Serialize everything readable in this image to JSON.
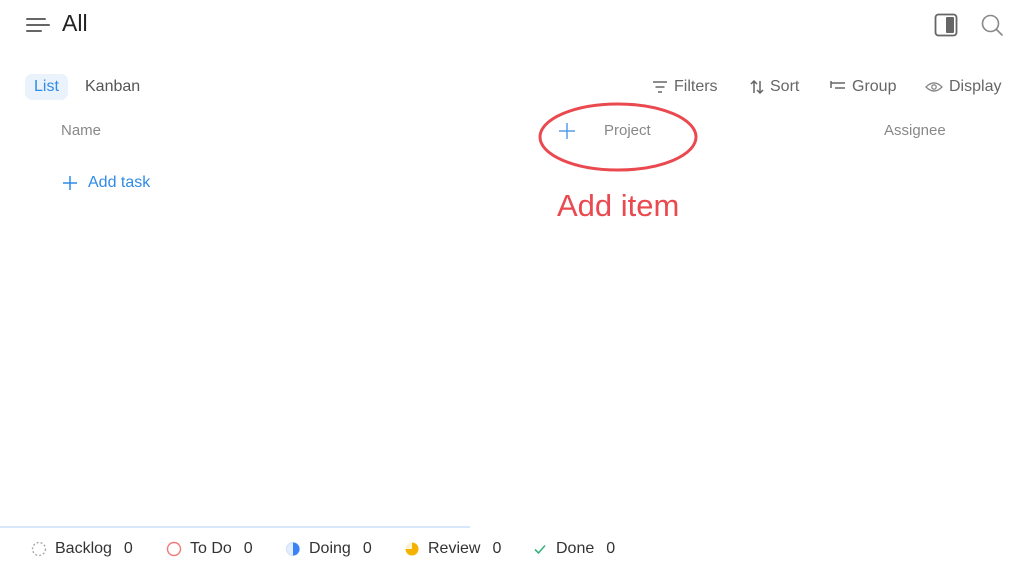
{
  "header": {
    "title": "All",
    "menu_icon": "menu-icon",
    "panel_icon": "side-panel-icon",
    "search_icon": "search-icon"
  },
  "views": {
    "tabs": [
      {
        "label": "List",
        "active": true
      },
      {
        "label": "Kanban",
        "active": false
      }
    ]
  },
  "toolbar": {
    "filters_label": "Filters",
    "sort_label": "Sort",
    "group_label": "Group",
    "display_label": "Display"
  },
  "columns": {
    "name": "Name",
    "project": "Project",
    "assignee": "Assignee"
  },
  "add_task_label": "Add task",
  "annotation": {
    "text": "Add item",
    "color": "#ea4a4f"
  },
  "status_bar": [
    {
      "label": "Backlog",
      "count": "0",
      "icon": "backlog-icon"
    },
    {
      "label": "To Do",
      "count": "0",
      "icon": "todo-icon"
    },
    {
      "label": "Doing",
      "count": "0",
      "icon": "doing-icon"
    },
    {
      "label": "Review",
      "count": "0",
      "icon": "review-icon"
    },
    {
      "label": "Done",
      "count": "0",
      "icon": "done-icon"
    }
  ],
  "colors": {
    "accent": "#2f8be6",
    "todo": "#f07a7a",
    "doing": "#3b82f6",
    "review": "#f5b301",
    "done": "#36b37e"
  }
}
